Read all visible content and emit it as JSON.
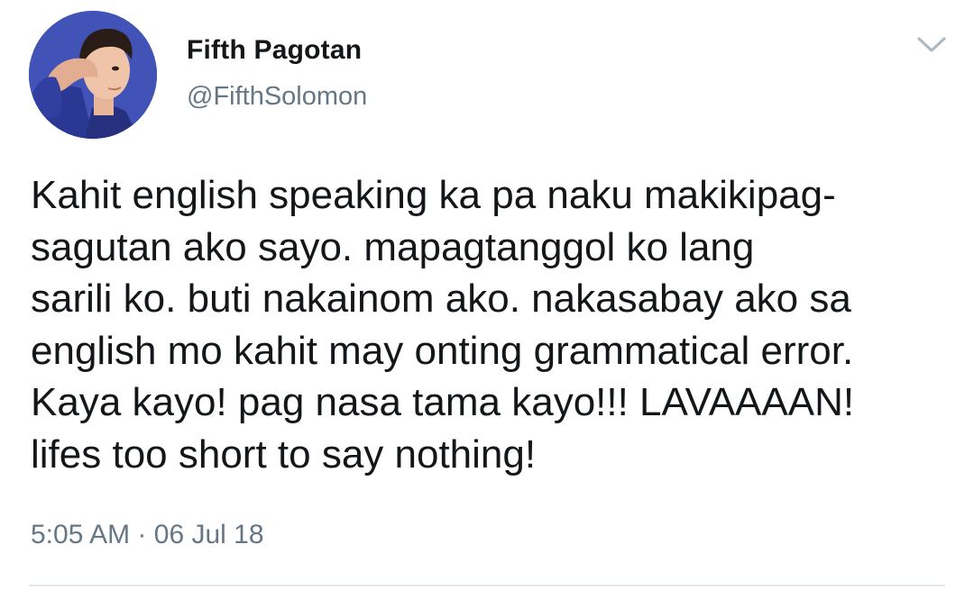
{
  "tweet": {
    "author": {
      "display_name": "Fifth Pagotan",
      "handle": "@FifthSolomon",
      "avatar_icon": "profile-photo"
    },
    "text": "Kahit english speaking ka pa naku makikipag-\nsagutan ako sayo. mapagtanggol ko lang\nsarili ko. buti nakainom ako. nakasabay ako sa\nenglish mo kahit may onting grammatical error.\nKaya kayo! pag nasa tama kayo!!! LAVAAAAN!\nlifes too short to say nothing!",
    "time": "5:05 AM",
    "separator": "·",
    "date": "06 Jul 18",
    "menu_icon": "chevron-down-icon"
  },
  "colors": {
    "text": "#14171a",
    "secondary": "#657786",
    "divider": "#e1e8ed",
    "avatar_bg": "#3b4aa8"
  }
}
